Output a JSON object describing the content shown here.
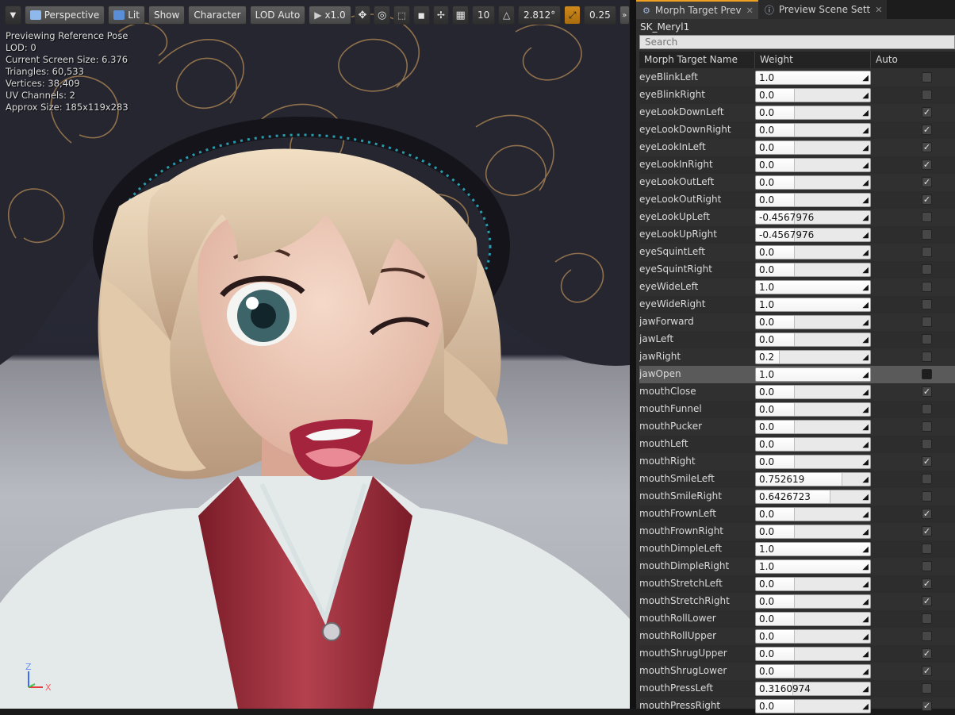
{
  "viewport": {
    "toolbar": {
      "perspective": "Perspective",
      "lit": "Lit",
      "show": "Show",
      "character": "Character",
      "lod": "LOD Auto",
      "speed": "x1.0",
      "grid": "10",
      "angle": "2.812°",
      "scale": "0.25"
    },
    "stats": {
      "line1": "Previewing Reference Pose",
      "line2": "LOD: 0",
      "line3": "Current Screen Size: 6.376",
      "line4": "Triangles: 60,533",
      "line5": "Vertices: 38,409",
      "line6": "UV Channels: 2",
      "line7": "Approx Size: 185x119x283"
    },
    "axis": {
      "z": "Z",
      "x": "X"
    }
  },
  "panel": {
    "tabs": [
      {
        "label": "Morph Target Prev"
      },
      {
        "label": "Preview Scene Sett"
      }
    ],
    "asset_name": "SK_Meryl1",
    "search_placeholder": "Search",
    "columns": {
      "name": "Morph Target Name",
      "weight": "Weight",
      "auto": "Auto"
    },
    "rows": [
      {
        "name": "eyeBlinkLeft",
        "weight": "1.0",
        "fill": 1.0,
        "auto": false,
        "selected": false
      },
      {
        "name": "eyeBlinkRight",
        "weight": "0.0",
        "fill": 0.0,
        "auto": false,
        "selected": false
      },
      {
        "name": "eyeLookDownLeft",
        "weight": "0.0",
        "fill": 0.0,
        "auto": true,
        "selected": false
      },
      {
        "name": "eyeLookDownRight",
        "weight": "0.0",
        "fill": 0.0,
        "auto": true,
        "selected": false
      },
      {
        "name": "eyeLookInLeft",
        "weight": "0.0",
        "fill": 0.0,
        "auto": true,
        "selected": false
      },
      {
        "name": "eyeLookInRight",
        "weight": "0.0",
        "fill": 0.0,
        "auto": true,
        "selected": false
      },
      {
        "name": "eyeLookOutLeft",
        "weight": "0.0",
        "fill": 0.0,
        "auto": true,
        "selected": false
      },
      {
        "name": "eyeLookOutRight",
        "weight": "0.0",
        "fill": 0.0,
        "auto": true,
        "selected": false
      },
      {
        "name": "eyeLookUpLeft",
        "weight": "-0.4567976",
        "fill": 0.0,
        "auto": false,
        "selected": false
      },
      {
        "name": "eyeLookUpRight",
        "weight": "-0.4567976",
        "fill": 0.0,
        "auto": false,
        "selected": false
      },
      {
        "name": "eyeSquintLeft",
        "weight": "0.0",
        "fill": 0.0,
        "auto": false,
        "selected": false
      },
      {
        "name": "eyeSquintRight",
        "weight": "0.0",
        "fill": 0.0,
        "auto": false,
        "selected": false
      },
      {
        "name": "eyeWideLeft",
        "weight": "1.0",
        "fill": 1.0,
        "auto": false,
        "selected": false
      },
      {
        "name": "eyeWideRight",
        "weight": "1.0",
        "fill": 1.0,
        "auto": false,
        "selected": false
      },
      {
        "name": "jawForward",
        "weight": "0.0",
        "fill": 0.0,
        "auto": false,
        "selected": false
      },
      {
        "name": "jawLeft",
        "weight": "0.0",
        "fill": 0.0,
        "auto": false,
        "selected": false
      },
      {
        "name": "jawRight",
        "weight": "0.2",
        "fill": 0.2,
        "auto": false,
        "selected": false
      },
      {
        "name": "jawOpen",
        "weight": "1.0",
        "fill": 1.0,
        "auto": false,
        "selected": true
      },
      {
        "name": "mouthClose",
        "weight": "0.0",
        "fill": 0.0,
        "auto": true,
        "selected": false
      },
      {
        "name": "mouthFunnel",
        "weight": "0.0",
        "fill": 0.0,
        "auto": false,
        "selected": false
      },
      {
        "name": "mouthPucker",
        "weight": "0.0",
        "fill": 0.0,
        "auto": false,
        "selected": false
      },
      {
        "name": "mouthLeft",
        "weight": "0.0",
        "fill": 0.0,
        "auto": false,
        "selected": false
      },
      {
        "name": "mouthRight",
        "weight": "0.0",
        "fill": 0.0,
        "auto": true,
        "selected": false
      },
      {
        "name": "mouthSmileLeft",
        "weight": "0.752619",
        "fill": 0.752619,
        "auto": false,
        "selected": false
      },
      {
        "name": "mouthSmileRight",
        "weight": "0.6426723",
        "fill": 0.6426723,
        "auto": false,
        "selected": false
      },
      {
        "name": "mouthFrownLeft",
        "weight": "0.0",
        "fill": 0.0,
        "auto": true,
        "selected": false
      },
      {
        "name": "mouthFrownRight",
        "weight": "0.0",
        "fill": 0.0,
        "auto": true,
        "selected": false
      },
      {
        "name": "mouthDimpleLeft",
        "weight": "1.0",
        "fill": 1.0,
        "auto": false,
        "selected": false
      },
      {
        "name": "mouthDimpleRight",
        "weight": "1.0",
        "fill": 1.0,
        "auto": false,
        "selected": false
      },
      {
        "name": "mouthStretchLeft",
        "weight": "0.0",
        "fill": 0.0,
        "auto": true,
        "selected": false
      },
      {
        "name": "mouthStretchRight",
        "weight": "0.0",
        "fill": 0.0,
        "auto": true,
        "selected": false
      },
      {
        "name": "mouthRollLower",
        "weight": "0.0",
        "fill": 0.0,
        "auto": false,
        "selected": false
      },
      {
        "name": "mouthRollUpper",
        "weight": "0.0",
        "fill": 0.0,
        "auto": false,
        "selected": false
      },
      {
        "name": "mouthShrugUpper",
        "weight": "0.0",
        "fill": 0.0,
        "auto": true,
        "selected": false
      },
      {
        "name": "mouthShrugLower",
        "weight": "0.0",
        "fill": 0.0,
        "auto": true,
        "selected": false
      },
      {
        "name": "mouthPressLeft",
        "weight": "0.3160974",
        "fill": 0.3160974,
        "auto": false,
        "selected": false
      },
      {
        "name": "mouthPressRight",
        "weight": "0.0",
        "fill": 0.0,
        "auto": true,
        "selected": false
      }
    ]
  },
  "colors": {
    "accent_orange": "#f0a020",
    "panel_bg": "#303030",
    "selected_row": "#5a5a5a",
    "hat": "#23232c",
    "hat_rim_dots": "#2ab4c8"
  },
  "icons": {
    "perspective": "camera-icon",
    "lit": "cube-icon",
    "speed": "play-icon",
    "translate": "translate-icon",
    "rotate": "rotate-icon",
    "scale": "scale-icon",
    "surface": "surface-snap-icon",
    "snap": "snap-icon",
    "grid": "grid-icon",
    "angle": "angle-icon",
    "scale_snap": "scale-snap-icon",
    "more": "chevron-right-icon",
    "tab_morph": "morph-tab-icon",
    "tab_scene": "info-icon"
  }
}
